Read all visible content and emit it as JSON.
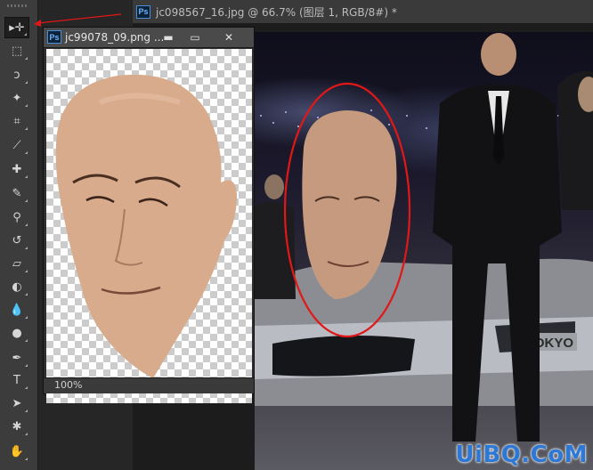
{
  "main_document": {
    "badge": "Ps",
    "tab_title": "jc098567_16.jpg @ 66.7% (图层 1, RGB/8#) *"
  },
  "floating_window": {
    "badge": "Ps",
    "title": "jc99078_09.png ...",
    "minimize": "▬",
    "maximize": "▭",
    "close": "✕",
    "zoom": "100%"
  },
  "tools": [
    {
      "name": "move-tool",
      "icon": "▸✛"
    },
    {
      "name": "rectangular-marquee-tool",
      "icon": "⬚"
    },
    {
      "name": "lasso-tool",
      "icon": "ↄ"
    },
    {
      "name": "magic-wand-tool",
      "icon": "✦"
    },
    {
      "name": "crop-tool",
      "icon": "⌗"
    },
    {
      "name": "eyedropper-tool",
      "icon": "⟋"
    },
    {
      "name": "healing-brush-tool",
      "icon": "✚"
    },
    {
      "name": "brush-tool",
      "icon": "✎"
    },
    {
      "name": "clone-stamp-tool",
      "icon": "⚲"
    },
    {
      "name": "history-brush-tool",
      "icon": "↺"
    },
    {
      "name": "eraser-tool",
      "icon": "▱"
    },
    {
      "name": "paint-bucket-tool",
      "icon": "◐"
    },
    {
      "name": "blur-tool",
      "icon": "💧"
    },
    {
      "name": "dodge-tool",
      "icon": "●"
    },
    {
      "name": "pen-tool",
      "icon": "✒"
    },
    {
      "name": "type-tool",
      "icon": "T"
    },
    {
      "name": "path-selection-tool",
      "icon": "➤"
    },
    {
      "name": "custom-shape-tool",
      "icon": "✱"
    },
    {
      "name": "hand-tool",
      "icon": "✋"
    }
  ],
  "poster": {
    "plate_text": "TOKYO"
  },
  "watermark": "UiBQ.CoM",
  "colors": {
    "annotation_red": "#e01818",
    "ps_blue": "#4c8ed6"
  }
}
